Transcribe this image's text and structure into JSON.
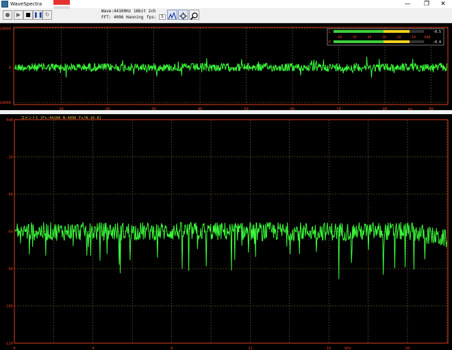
{
  "window": {
    "title": "WaveSpectra",
    "minimize_glyph": "—",
    "maximize_glyph": "❐",
    "close_glyph": "✕"
  },
  "toolbar": {
    "wave_info": "Wave:44100Hz 16bit 2ch",
    "fft_info": "FFT: 4096 Hanning",
    "fps_label": "fps:",
    "fps_value": "5",
    "icons": [
      "record-icon",
      "play-icon",
      "stop-icon",
      "pause-icon",
      "loop-icon",
      "waveform-view-icon",
      "settings-icon",
      "zoom-icon"
    ]
  },
  "wave_panel": {
    "y_ticks": [
      "10000",
      "0",
      "-10000"
    ],
    "x_ticks": [
      "10",
      "20",
      "30",
      "40",
      "50",
      "60",
      "70",
      "80",
      "90"
    ],
    "x_unit": "ms",
    "trace_color": "#3cff3c",
    "level_meter": {
      "scale": [
        "-60",
        "-50",
        "-40",
        "-30",
        "-20",
        "-10",
        "0dB"
      ],
      "left_label": "L",
      "right_label": "R",
      "left_value": "-0.5",
      "right_value": "-0.4",
      "left_level": 0.78,
      "right_level": 0.78
    }
  },
  "fft_panel": {
    "comment": "コメント1  [Fs:44100 N:4096 Fs/N:10.8]",
    "y_ticks": [
      "0dB",
      "-20",
      "-40",
      "-60",
      "-80",
      "-100",
      "-120"
    ],
    "x_ticks": [
      "0",
      "4",
      "8",
      "12",
      "16",
      "20"
    ],
    "x_unit": "kHz",
    "trace_color": "#3cff3c"
  }
}
